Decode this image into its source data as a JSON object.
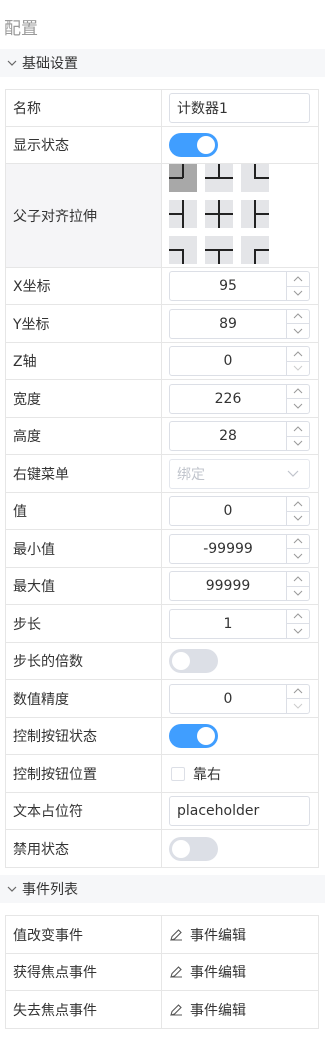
{
  "panel": {
    "title": "配置"
  },
  "sections": {
    "basic": {
      "title": "基础设置"
    },
    "events": {
      "title": "事件列表"
    }
  },
  "fields": {
    "name": {
      "label": "名称",
      "value": "计数器1"
    },
    "visible": {
      "label": "显示状态",
      "on": true
    },
    "align": {
      "label": "父子对齐拉伸"
    },
    "x": {
      "label": "X坐标",
      "value": "95"
    },
    "y": {
      "label": "Y坐标",
      "value": "89"
    },
    "z": {
      "label": "Z轴",
      "value": "0"
    },
    "width": {
      "label": "宽度",
      "value": "226"
    },
    "height": {
      "label": "高度",
      "value": "28"
    },
    "context_menu": {
      "label": "右键菜单",
      "placeholder": "绑定"
    },
    "value": {
      "label": "值",
      "value": "0"
    },
    "min": {
      "label": "最小值",
      "value": "-99999"
    },
    "max": {
      "label": "最大值",
      "value": "99999"
    },
    "step": {
      "label": "步长",
      "value": "1"
    },
    "step_multiple": {
      "label": "步长的倍数",
      "on": false
    },
    "precision": {
      "label": "数值精度",
      "value": "0"
    },
    "controls_state": {
      "label": "控制按钮状态",
      "on": true
    },
    "controls_position": {
      "label": "控制按钮位置",
      "option": "靠右",
      "checked": false
    },
    "placeholder": {
      "label": "文本占位符",
      "value": "placeholder"
    },
    "disabled": {
      "label": "禁用状态",
      "on": false
    }
  },
  "events": [
    {
      "label": "值改变事件",
      "action": "事件编辑"
    },
    {
      "label": "获得焦点事件",
      "action": "事件编辑"
    },
    {
      "label": "失去焦点事件",
      "action": "事件编辑"
    }
  ],
  "colors": {
    "accent": "#409eff",
    "toggle_off": "#dcdfe6",
    "align_active": "#a8a8a8"
  },
  "icons": {
    "section_toggle": "chevron-down-icon",
    "event_edit": "pencil-icon"
  }
}
